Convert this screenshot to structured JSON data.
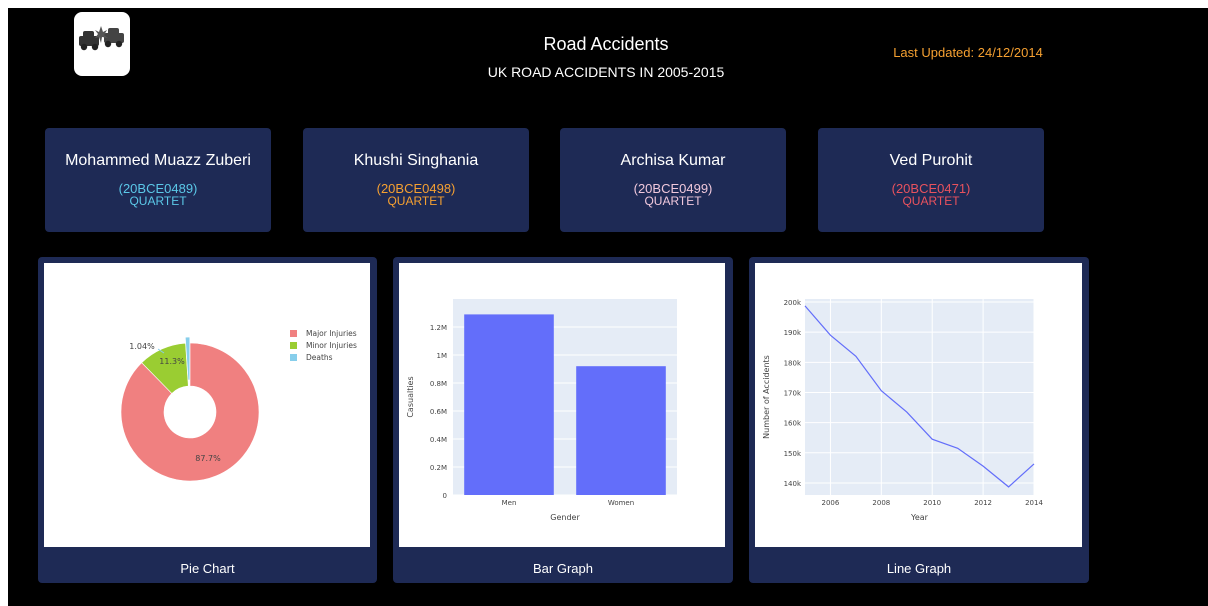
{
  "header": {
    "title": "Road Accidents",
    "subtitle": "UK ROAD ACCIDENTS IN 2005-2015",
    "last_updated": "Last Updated: 24/12/2014",
    "logo_icon": "car-crash-icon"
  },
  "members": [
    {
      "name": "Mohammed Muazz Zuberi",
      "id": "(20BCE0489)",
      "team": "QUARTET",
      "color": "#5bc8e8"
    },
    {
      "name": "Khushi Singhania",
      "id": "(20BCE0498)",
      "team": "QUARTET",
      "color": "#f5a031"
    },
    {
      "name": "Archisa Kumar",
      "id": "(20BCE0499)",
      "team": "QUARTET",
      "color": "#f0c8dc"
    },
    {
      "name": "Ved Purohit",
      "id": "(20BCE0471)",
      "team": "QUARTET",
      "color": "#e8525e"
    }
  ],
  "panels": {
    "pie_caption": "Pie Chart",
    "bar_caption": "Bar Graph",
    "line_caption": "Line Graph"
  },
  "chart_data": [
    {
      "type": "pie",
      "hole": true,
      "labels": [
        "Major Injuries",
        "Minor Injuries",
        "Deaths"
      ],
      "values": [
        87.7,
        11.3,
        1.04
      ],
      "text_labels": [
        "87.7%",
        "11.3%",
        "1.04%"
      ],
      "colors": [
        "#f08080",
        "#9acd32",
        "#87ceeb"
      ],
      "legend": "top-right"
    },
    {
      "type": "bar",
      "categories": [
        "Men",
        "Women"
      ],
      "values": [
        1290000,
        920000
      ],
      "xlabel": "Gender",
      "ylabel": "Casualties",
      "ylim": [
        0,
        1400000
      ],
      "yticks": [
        0,
        200000,
        400000,
        600000,
        800000,
        1000000,
        1200000
      ],
      "ytick_labels": [
        "0",
        "0.2M",
        "0.4M",
        "0.6M",
        "0.8M",
        "1M",
        "1.2M"
      ],
      "color": "#636efa"
    },
    {
      "type": "line",
      "x": [
        2005,
        2006,
        2007,
        2008,
        2009,
        2010,
        2011,
        2012,
        2013,
        2014
      ],
      "y": [
        198700,
        189000,
        182000,
        170600,
        163500,
        154500,
        151500,
        145600,
        138700,
        146300
      ],
      "xlabel": "Year",
      "ylabel": "Number of Accidents",
      "xlim": [
        2005,
        2014
      ],
      "ylim": [
        136000,
        201000
      ],
      "xticks": [
        2006,
        2008,
        2010,
        2012,
        2014
      ],
      "xtick_labels": [
        "2006",
        "2008",
        "2010",
        "2012",
        "2014"
      ],
      "yticks": [
        140000,
        150000,
        160000,
        170000,
        180000,
        190000,
        200000
      ],
      "ytick_labels": [
        "140k",
        "150k",
        "160k",
        "170k",
        "180k",
        "190k",
        "200k"
      ],
      "color": "#636efa"
    }
  ]
}
